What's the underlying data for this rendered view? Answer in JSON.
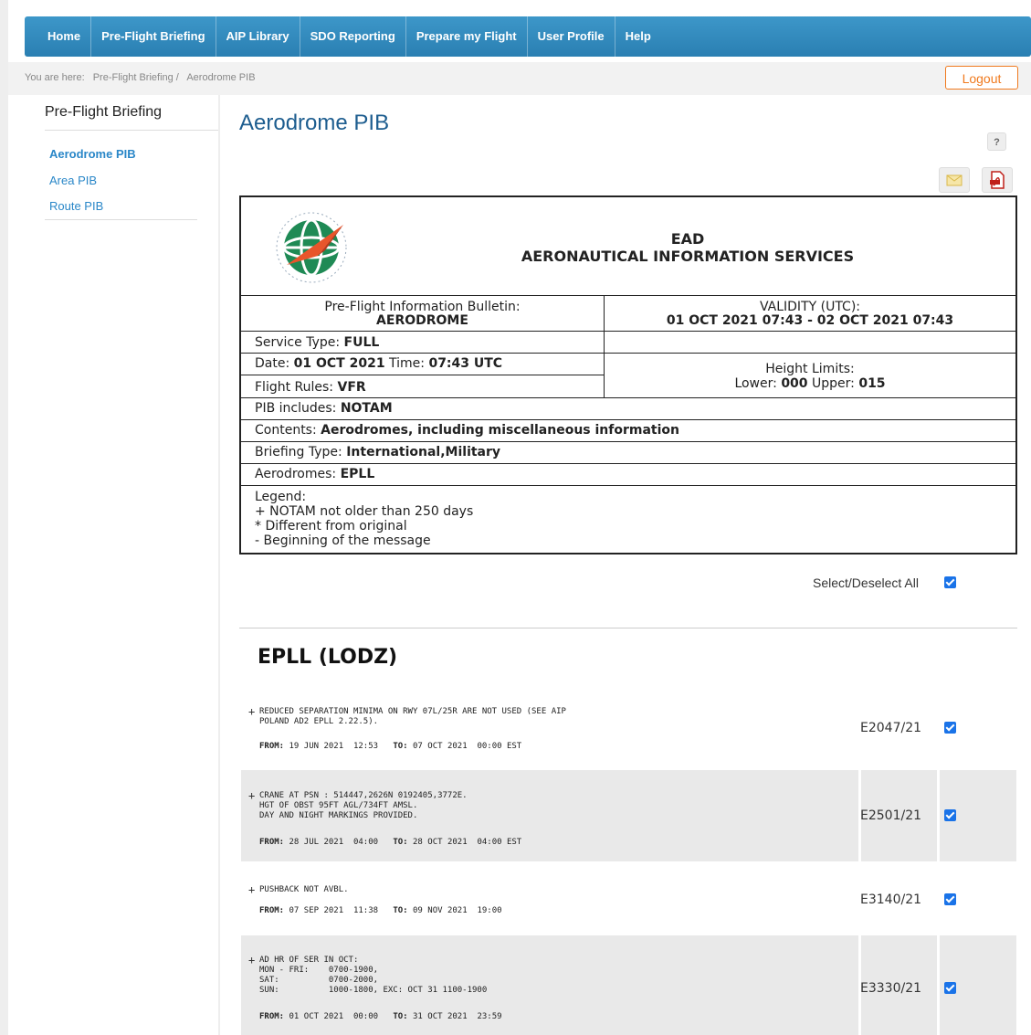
{
  "nav": {
    "items": [
      "Home",
      "Pre-Flight Briefing",
      "AIP Library",
      "SDO Reporting",
      "Prepare my Flight",
      "User Profile",
      "Help"
    ]
  },
  "breadcrumb": {
    "prefix": "You are here:",
    "items": [
      "Pre-Flight Briefing /",
      "Aerodrome PIB"
    ]
  },
  "logout_label": "Logout",
  "sidebar": {
    "title": "Pre-Flight Briefing",
    "items": [
      {
        "label": "Aerodrome PIB",
        "active": true
      },
      {
        "label": "Area PIB",
        "active": false
      },
      {
        "label": "Route PIB",
        "active": false
      }
    ]
  },
  "page_title": "Aerodrome PIB",
  "help_label": "?",
  "icons": {
    "help": "question-icon",
    "email": "envelope-icon",
    "pdf": "pdf-icon",
    "logo": "ead-globe-logo"
  },
  "bulletin": {
    "org_line1": "EAD",
    "org_line2": "AERONAUTICAL INFORMATION SERVICES",
    "pib_label": "Pre-Flight Information Bulletin:",
    "pib_value": "AERODROME",
    "validity_label": "VALIDITY (UTC):",
    "validity_value": "01 OCT 2021 07:43 - 02 OCT 2021 07:43",
    "service_label": "Service Type:",
    "service_value": "FULL",
    "date_label": "Date:",
    "date_value": "01 OCT 2021",
    "time_label": "Time:",
    "time_value": "07:43 UTC",
    "rules_label": "Flight Rules:",
    "rules_value": "VFR",
    "height_label": "Height Limits:",
    "lower_label": "Lower:",
    "lower_value": "000",
    "upper_label": "Upper:",
    "upper_value": "015",
    "includes_label": "PIB includes:",
    "includes_value": "NOTAM",
    "contents_label": "Contents:",
    "contents_value": "Aerodromes, including miscellaneous information",
    "briefing_label": "Briefing Type:",
    "briefing_value": "International,Military",
    "aerodromes_label": "Aerodromes:",
    "aerodromes_value": "EPLL",
    "legend_title": "Legend:",
    "legend_1": "+ NOTAM not older than 250 days",
    "legend_2": "* Different from original",
    "legend_3": "- Beginning of the message"
  },
  "select_all_label": "Select/Deselect All",
  "aerodrome_title": "EPLL (LODZ)",
  "notams": [
    {
      "marker": "+",
      "text": "REDUCED SEPARATION MINIMA ON RWY 07L/25R ARE NOT USED (SEE AIP\nPOLAND AD2 EPLL 2.22.5).",
      "from": "19 JUN 2021  12:53",
      "to": "07 OCT 2021  00:00 EST",
      "id": "E2047/21",
      "checked": true
    },
    {
      "marker": "+",
      "text": "CRANE AT PSN : 514447,2626N 0192405,3772E.\nHGT OF OBST 95FT AGL/734FT AMSL.\nDAY AND NIGHT MARKINGS PROVIDED.",
      "from": "28 JUL 2021  04:00",
      "to": "28 OCT 2021  04:00 EST",
      "id": "E2501/21",
      "checked": true
    },
    {
      "marker": "+",
      "text": "PUSHBACK NOT AVBL.",
      "from": "07 SEP 2021  11:38",
      "to": "09 NOV 2021  19:00",
      "id": "E3140/21",
      "checked": true
    },
    {
      "marker": "+",
      "text": "AD HR OF SER IN OCT:\nMON - FRI:    0700-1900,\nSAT:          0700-2000,\nSUN:          1000-1800, EXC: OCT 31 1100-1900",
      "from": "01 OCT 2021  00:00",
      "to": "31 OCT 2021  23:59",
      "id": "E3330/21",
      "checked": true
    }
  ],
  "labels": {
    "from": "FROM:",
    "to": "TO:"
  }
}
